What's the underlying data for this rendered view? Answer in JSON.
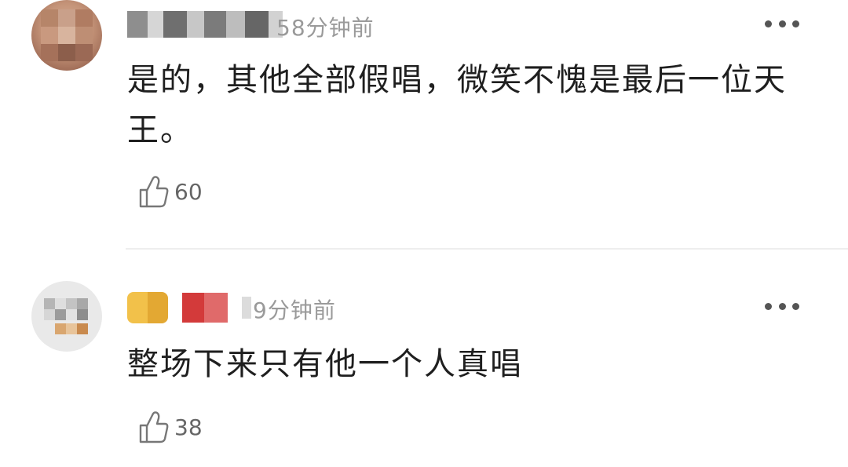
{
  "comments": [
    {
      "time": "58分钟前",
      "content": "是的，其他全部假唱，微笑不愧是最后一位天王。",
      "likes": "60"
    },
    {
      "time": "9分钟前",
      "content": "整场下来只有他一个人真唱",
      "likes": "38"
    }
  ],
  "icons": {
    "more": "more-horizontal-icon",
    "like": "thumbs-up-icon"
  },
  "colors": {
    "text": "#1f1f1f",
    "meta": "#9a9a9a",
    "divider": "#eeeeee"
  }
}
